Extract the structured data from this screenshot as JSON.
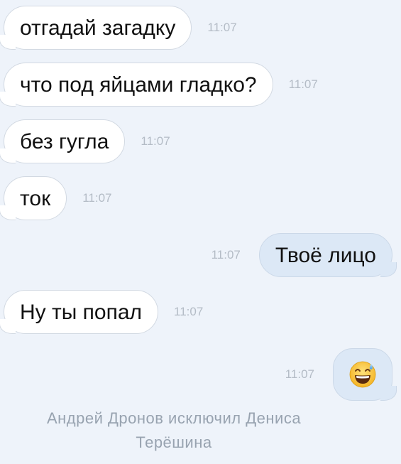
{
  "messages": [
    {
      "text": "отгадай загадку",
      "time": "11:07",
      "direction": "incoming"
    },
    {
      "text": "что под яйцами гладко?",
      "time": "11:07",
      "direction": "incoming"
    },
    {
      "text": "без гугла",
      "time": "11:07",
      "direction": "incoming"
    },
    {
      "text": "ток",
      "time": "11:07",
      "direction": "incoming"
    },
    {
      "text": "Твоё лицо",
      "time": "11:07",
      "direction": "outgoing"
    },
    {
      "text": "Ну ты попал",
      "time": "11:07",
      "direction": "incoming"
    },
    {
      "emoji": "grinning-face-with-sweat",
      "time": "11:07",
      "direction": "outgoing"
    }
  ],
  "system_message": {
    "line1": "Андрей Дронов исключил Дениса",
    "line2": "Терёшина"
  },
  "colors": {
    "background": "#eef3fa",
    "incoming_bubble": "#ffffff",
    "outgoing_bubble": "#dce8f6",
    "timestamp": "#b4bcc6",
    "system_text": "#98a3b0"
  }
}
